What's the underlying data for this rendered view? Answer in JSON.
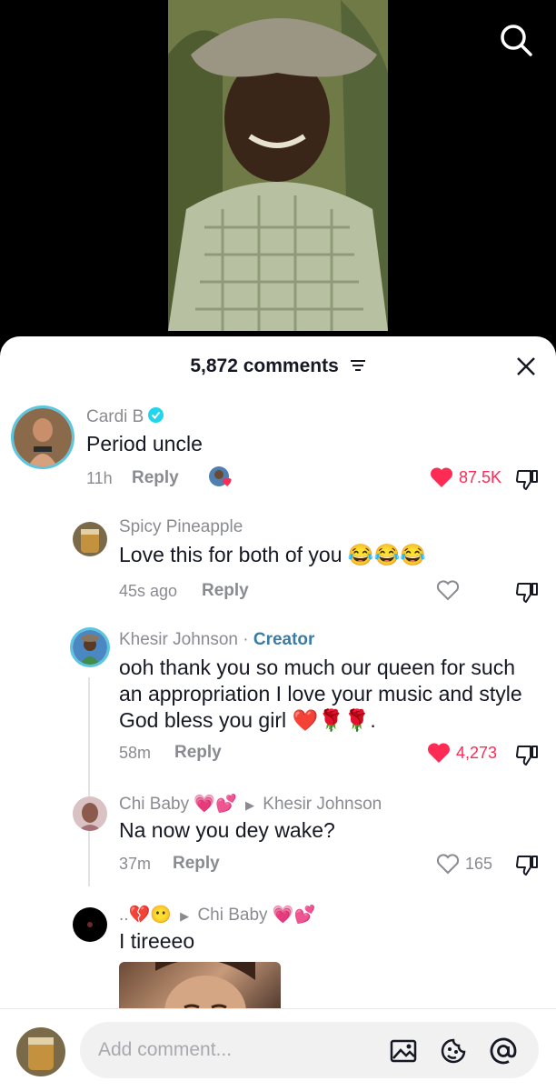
{
  "comments_header": {
    "count": "5,872 comments"
  },
  "comments": [
    {
      "name": "Cardi B",
      "text": "Period uncle",
      "time": "11h",
      "reply": "Reply",
      "likes": "87.5K",
      "liked": true
    },
    {
      "name": "Spicy Pineapple",
      "text": "Love this for both of you 😂😂😂",
      "time": "45s ago",
      "reply": "Reply",
      "likes": "",
      "liked": false
    },
    {
      "name": "Khesir Johnson",
      "badge": "Creator",
      "text": "ooh thank you so much our queen for such an appropriation I love your music and style God bless you girl ❤️🌹🌹.",
      "time": "58m",
      "reply": "Reply",
      "likes": "4,273",
      "liked": true
    },
    {
      "name": "Chi Baby 💗💕",
      "reply_to": "Khesir Johnson",
      "text": "Na now you dey wake?",
      "time": "37m",
      "reply": "Reply",
      "likes": "165",
      "liked": false
    },
    {
      "name": "..💔😶",
      "reply_to": "Chi Baby 💗💕",
      "text": "I tireeeo"
    }
  ],
  "composer": {
    "placeholder": "Add comment..."
  },
  "colors": {
    "like_red": "#fe2c55",
    "verified": "#20d5ec",
    "creator": "#3a7ca5"
  },
  "icons": [
    "search-icon",
    "close-icon",
    "sort-icon",
    "heart-icon",
    "dislike-icon",
    "image-icon",
    "emoji-icon",
    "mention-icon"
  ]
}
